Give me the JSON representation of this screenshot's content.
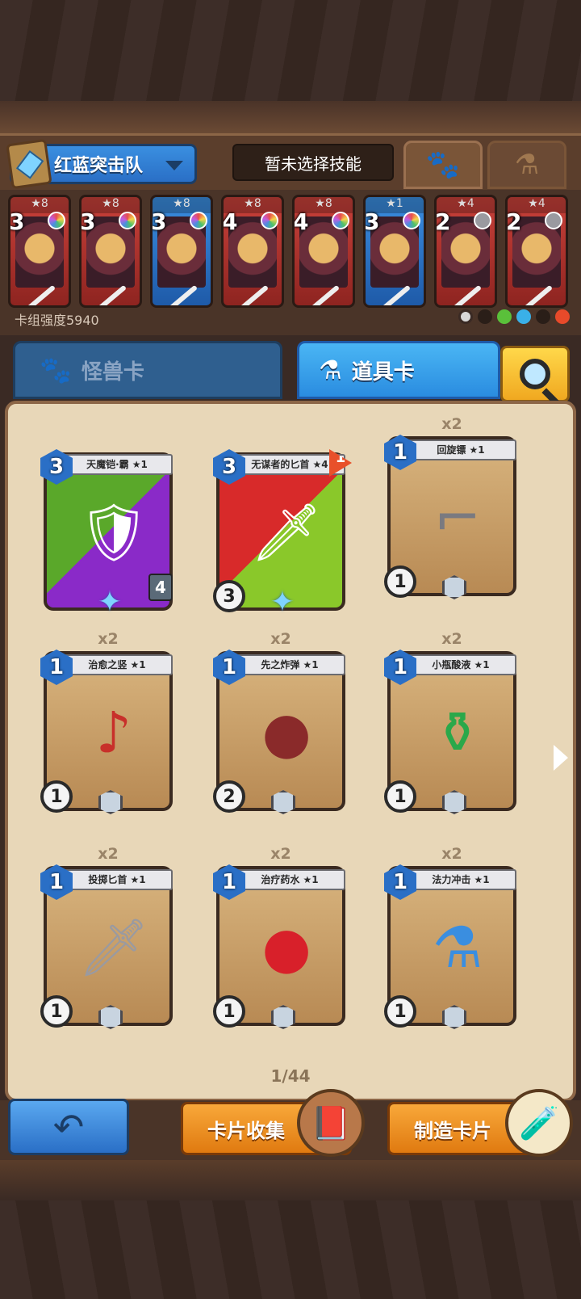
{
  "header": {
    "deck_name": "红蓝突击队",
    "skill_label": "暂未选择技能",
    "paw_tab_icon": "paw-icon",
    "flask_tab_icon": "flask-icon"
  },
  "deck": {
    "cards": [
      {
        "stars": "★8",
        "cost": "3",
        "color": "red"
      },
      {
        "stars": "★8",
        "cost": "3",
        "color": "red"
      },
      {
        "stars": "★8",
        "cost": "3",
        "color": "blue"
      },
      {
        "stars": "★8",
        "cost": "4",
        "color": "red"
      },
      {
        "stars": "★8",
        "cost": "4",
        "color": "red"
      },
      {
        "stars": "★1",
        "cost": "3",
        "color": "blue"
      },
      {
        "stars": "★4",
        "cost": "2",
        "color": "red"
      },
      {
        "stars": "★4",
        "cost": "2",
        "color": "red"
      }
    ],
    "power_label": "卡组强度5940",
    "element_colors": [
      "#d8d8d8",
      "#3a2a24",
      "#5ac03a",
      "#3ab0e8",
      "#3a2a24",
      "#e84a2a"
    ]
  },
  "tabs": {
    "monster": "怪兽卡",
    "item": "道具卡"
  },
  "cards": [
    {
      "title": "天魔铠·霸 ★1",
      "cost": "3",
      "count": "",
      "speed": "",
      "atk": "4",
      "kind": "green"
    },
    {
      "title": "无谋者的匕首 ★4",
      "cost": "3",
      "count": "",
      "speed": "3",
      "flag": "1",
      "kind": "redc"
    },
    {
      "title": "回旋镖 ★1",
      "cost": "1",
      "count": "x2",
      "speed": "1",
      "kind": "plain"
    },
    {
      "title": "治愈之竖 ★1",
      "cost": "1",
      "count": "x2",
      "speed": "1",
      "kind": "plain"
    },
    {
      "title": "先之炸弹 ★1",
      "cost": "1",
      "count": "x2",
      "speed": "2",
      "kind": "plain"
    },
    {
      "title": "小瓶酸液 ★1",
      "cost": "1",
      "count": "x2",
      "speed": "1",
      "kind": "plain"
    },
    {
      "title": "投掷匕首 ★1",
      "cost": "1",
      "count": "x2",
      "speed": "1",
      "kind": "plain"
    },
    {
      "title": "治疗药水 ★1",
      "cost": "1",
      "count": "x2",
      "speed": "1",
      "kind": "plain"
    },
    {
      "title": "法力冲击 ★1",
      "cost": "1",
      "count": "x2",
      "speed": "1",
      "kind": "plain"
    }
  ],
  "pager": "1/44",
  "bottom": {
    "collect_label": "卡片收集",
    "craft_label": "制造卡片"
  }
}
